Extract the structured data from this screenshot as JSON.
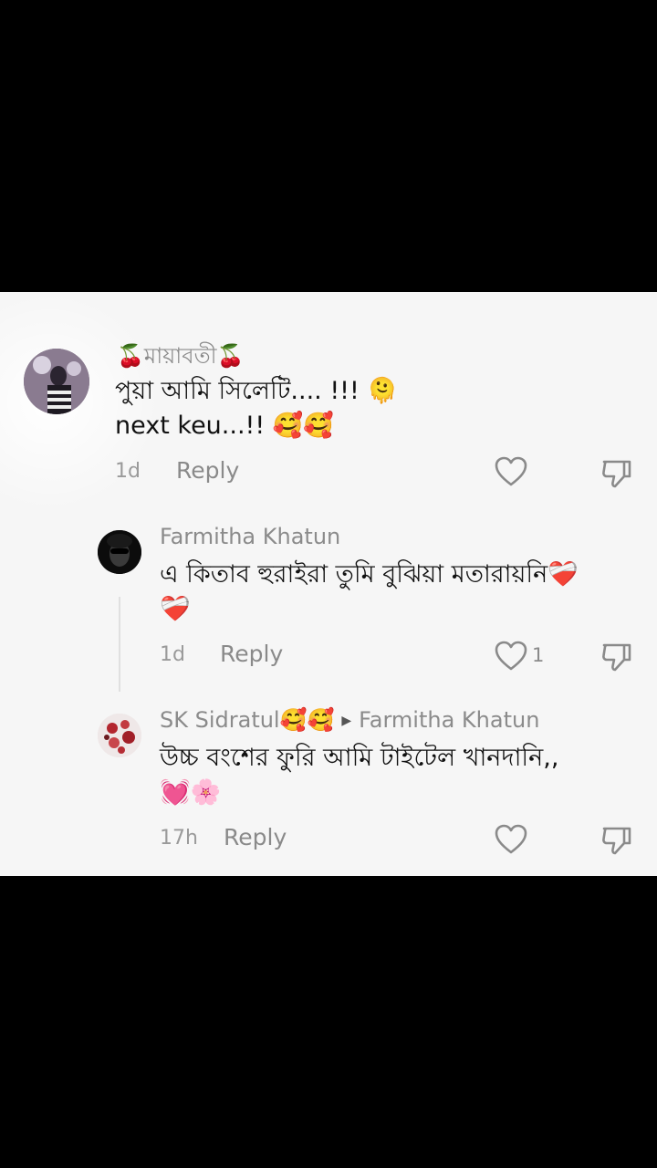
{
  "comments": [
    {
      "author": "🍒মায়াবতী🍒",
      "line1": "পুয়া আমি সিলেটি.... !!! 🫠",
      "line2": "next keu...!! 🥰🥰",
      "time": "1d",
      "reply": "Reply"
    },
    {
      "author": "Farmitha Khatun",
      "line1": "এ কিতাব হুরাইরা তুমি বুঝিয়া মতারায়নি❤️‍🩹",
      "line2": "❤️‍🩹",
      "time": "1d",
      "reply": "Reply",
      "likes": "1"
    },
    {
      "author": "SK Sidratul🥰🥰",
      "reply_to": "Farmitha Khatun",
      "line1": "উচ্চ বংশের ফুরি আমি টাইটেল খানদানি,,",
      "line2": "💓🌸",
      "time": "17h",
      "reply": "Reply"
    }
  ],
  "icons": {
    "like": "heart-outline-icon",
    "dislike": "thumb-down-icon"
  }
}
